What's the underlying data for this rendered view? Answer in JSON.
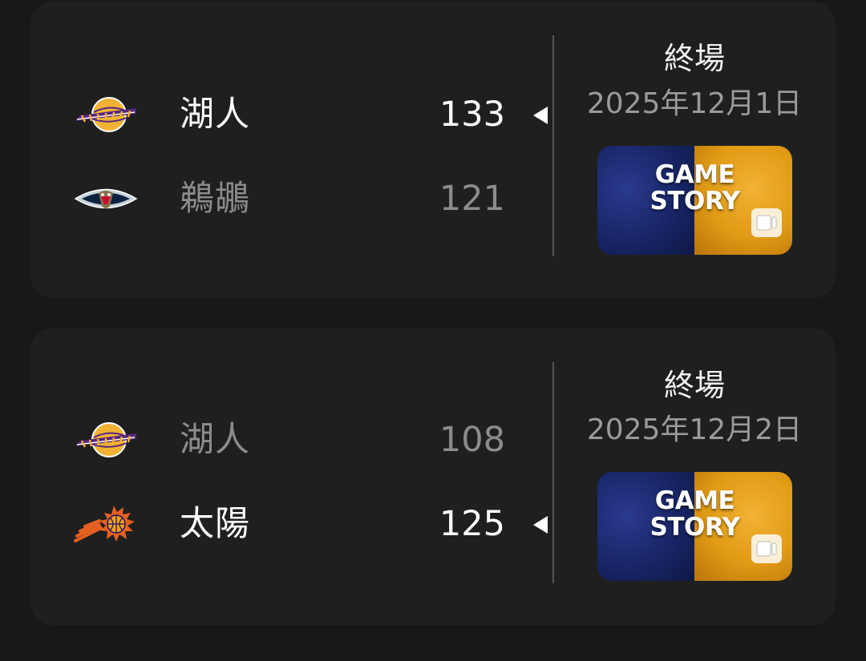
{
  "games": [
    {
      "status": "終場",
      "date": "2025年12月1日",
      "story": {
        "line1": "GAME",
        "line2": "STORY",
        "left_color": "#182566",
        "right_color": "#e09a15"
      },
      "teams": [
        {
          "name": "湖人",
          "score": "133",
          "logo": "lakers-logo",
          "winner": true
        },
        {
          "name": "鵜鶘",
          "score": "121",
          "logo": "pelicans-logo",
          "winner": false
        }
      ]
    },
    {
      "status": "終場",
      "date": "2025年12月2日",
      "story": {
        "line1": "GAME",
        "line2": "STORY",
        "left_color": "#182566",
        "right_color": "#e09a15"
      },
      "teams": [
        {
          "name": "湖人",
          "score": "108",
          "logo": "lakers-logo",
          "winner": false
        },
        {
          "name": "太陽",
          "score": "125",
          "logo": "suns-logo",
          "winner": true
        }
      ]
    }
  ],
  "colors": {
    "background": "#181818",
    "card": "#1f1f1f",
    "winner_text": "#ffffff",
    "loser_text": "#8c8c8c",
    "divider": "#555555"
  }
}
